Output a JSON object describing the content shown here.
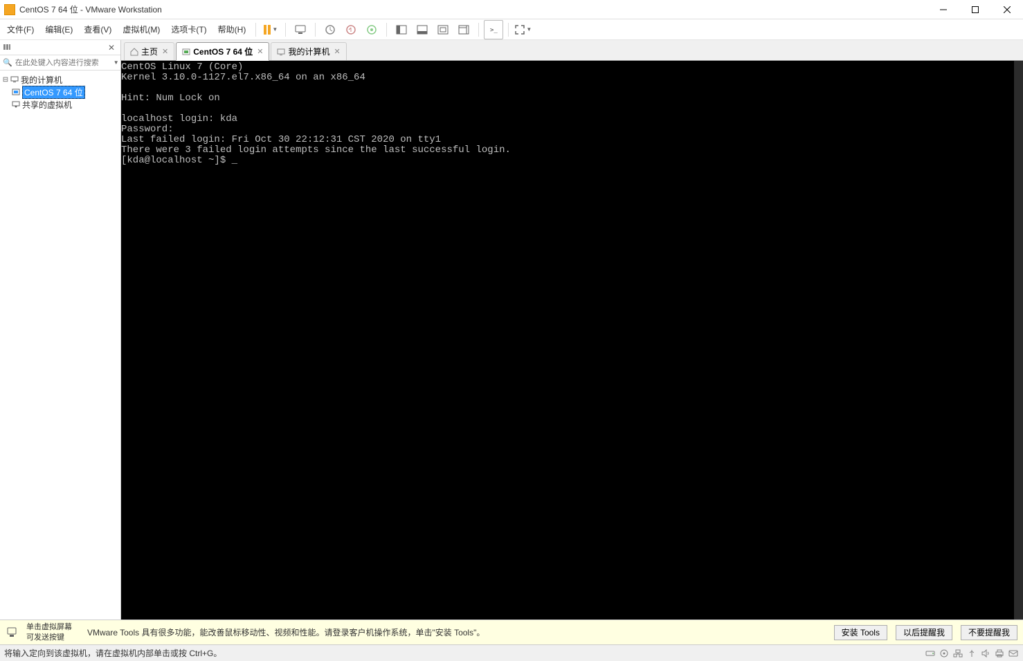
{
  "window": {
    "title": "CentOS 7 64 位 - VMware Workstation"
  },
  "menu": {
    "file": "文件(F)",
    "edit": "编辑(E)",
    "view": "查看(V)",
    "vm": "虚拟机(M)",
    "tabs": "选项卡(T)",
    "help": "帮助(H)"
  },
  "library": {
    "search_placeholder": "在此处键入内容进行搜索",
    "root": "我的计算机",
    "vm1": "CentOS 7 64 位",
    "shared": "共享的虚拟机"
  },
  "tabs": {
    "home": "主页",
    "centos": "CentOS 7 64 位",
    "mycomputer": "我的计算机"
  },
  "console": {
    "l0": "CentOS Linux 7 (Core)",
    "l1": "Kernel 3.10.0-1127.el7.x86_64 on an x86_64",
    "l2": "",
    "l3": "Hint: Num Lock on",
    "l4": "",
    "l5": "localhost login: kda",
    "l6": "Password:",
    "l7": "Last failed login: Fri Oct 30 22:12:31 CST 2020 on tty1",
    "l8": "There were 3 failed login attempts since the last successful login.",
    "l9": "[kda@localhost ~]$ _"
  },
  "notify": {
    "hint_l1": "单击虚拟屏幕",
    "hint_l2": "可发送按键",
    "msg": "VMware Tools 具有很多功能，能改善鼠标移动性、视频和性能。请登录客户机操作系统，单击\"安装 Tools\"。",
    "btn_install": "安装 Tools",
    "btn_later": "以后提醒我",
    "btn_never": "不要提醒我"
  },
  "status": {
    "msg": "将输入定向到该虚拟机，请在虚拟机内部单击或按 Ctrl+G。"
  }
}
